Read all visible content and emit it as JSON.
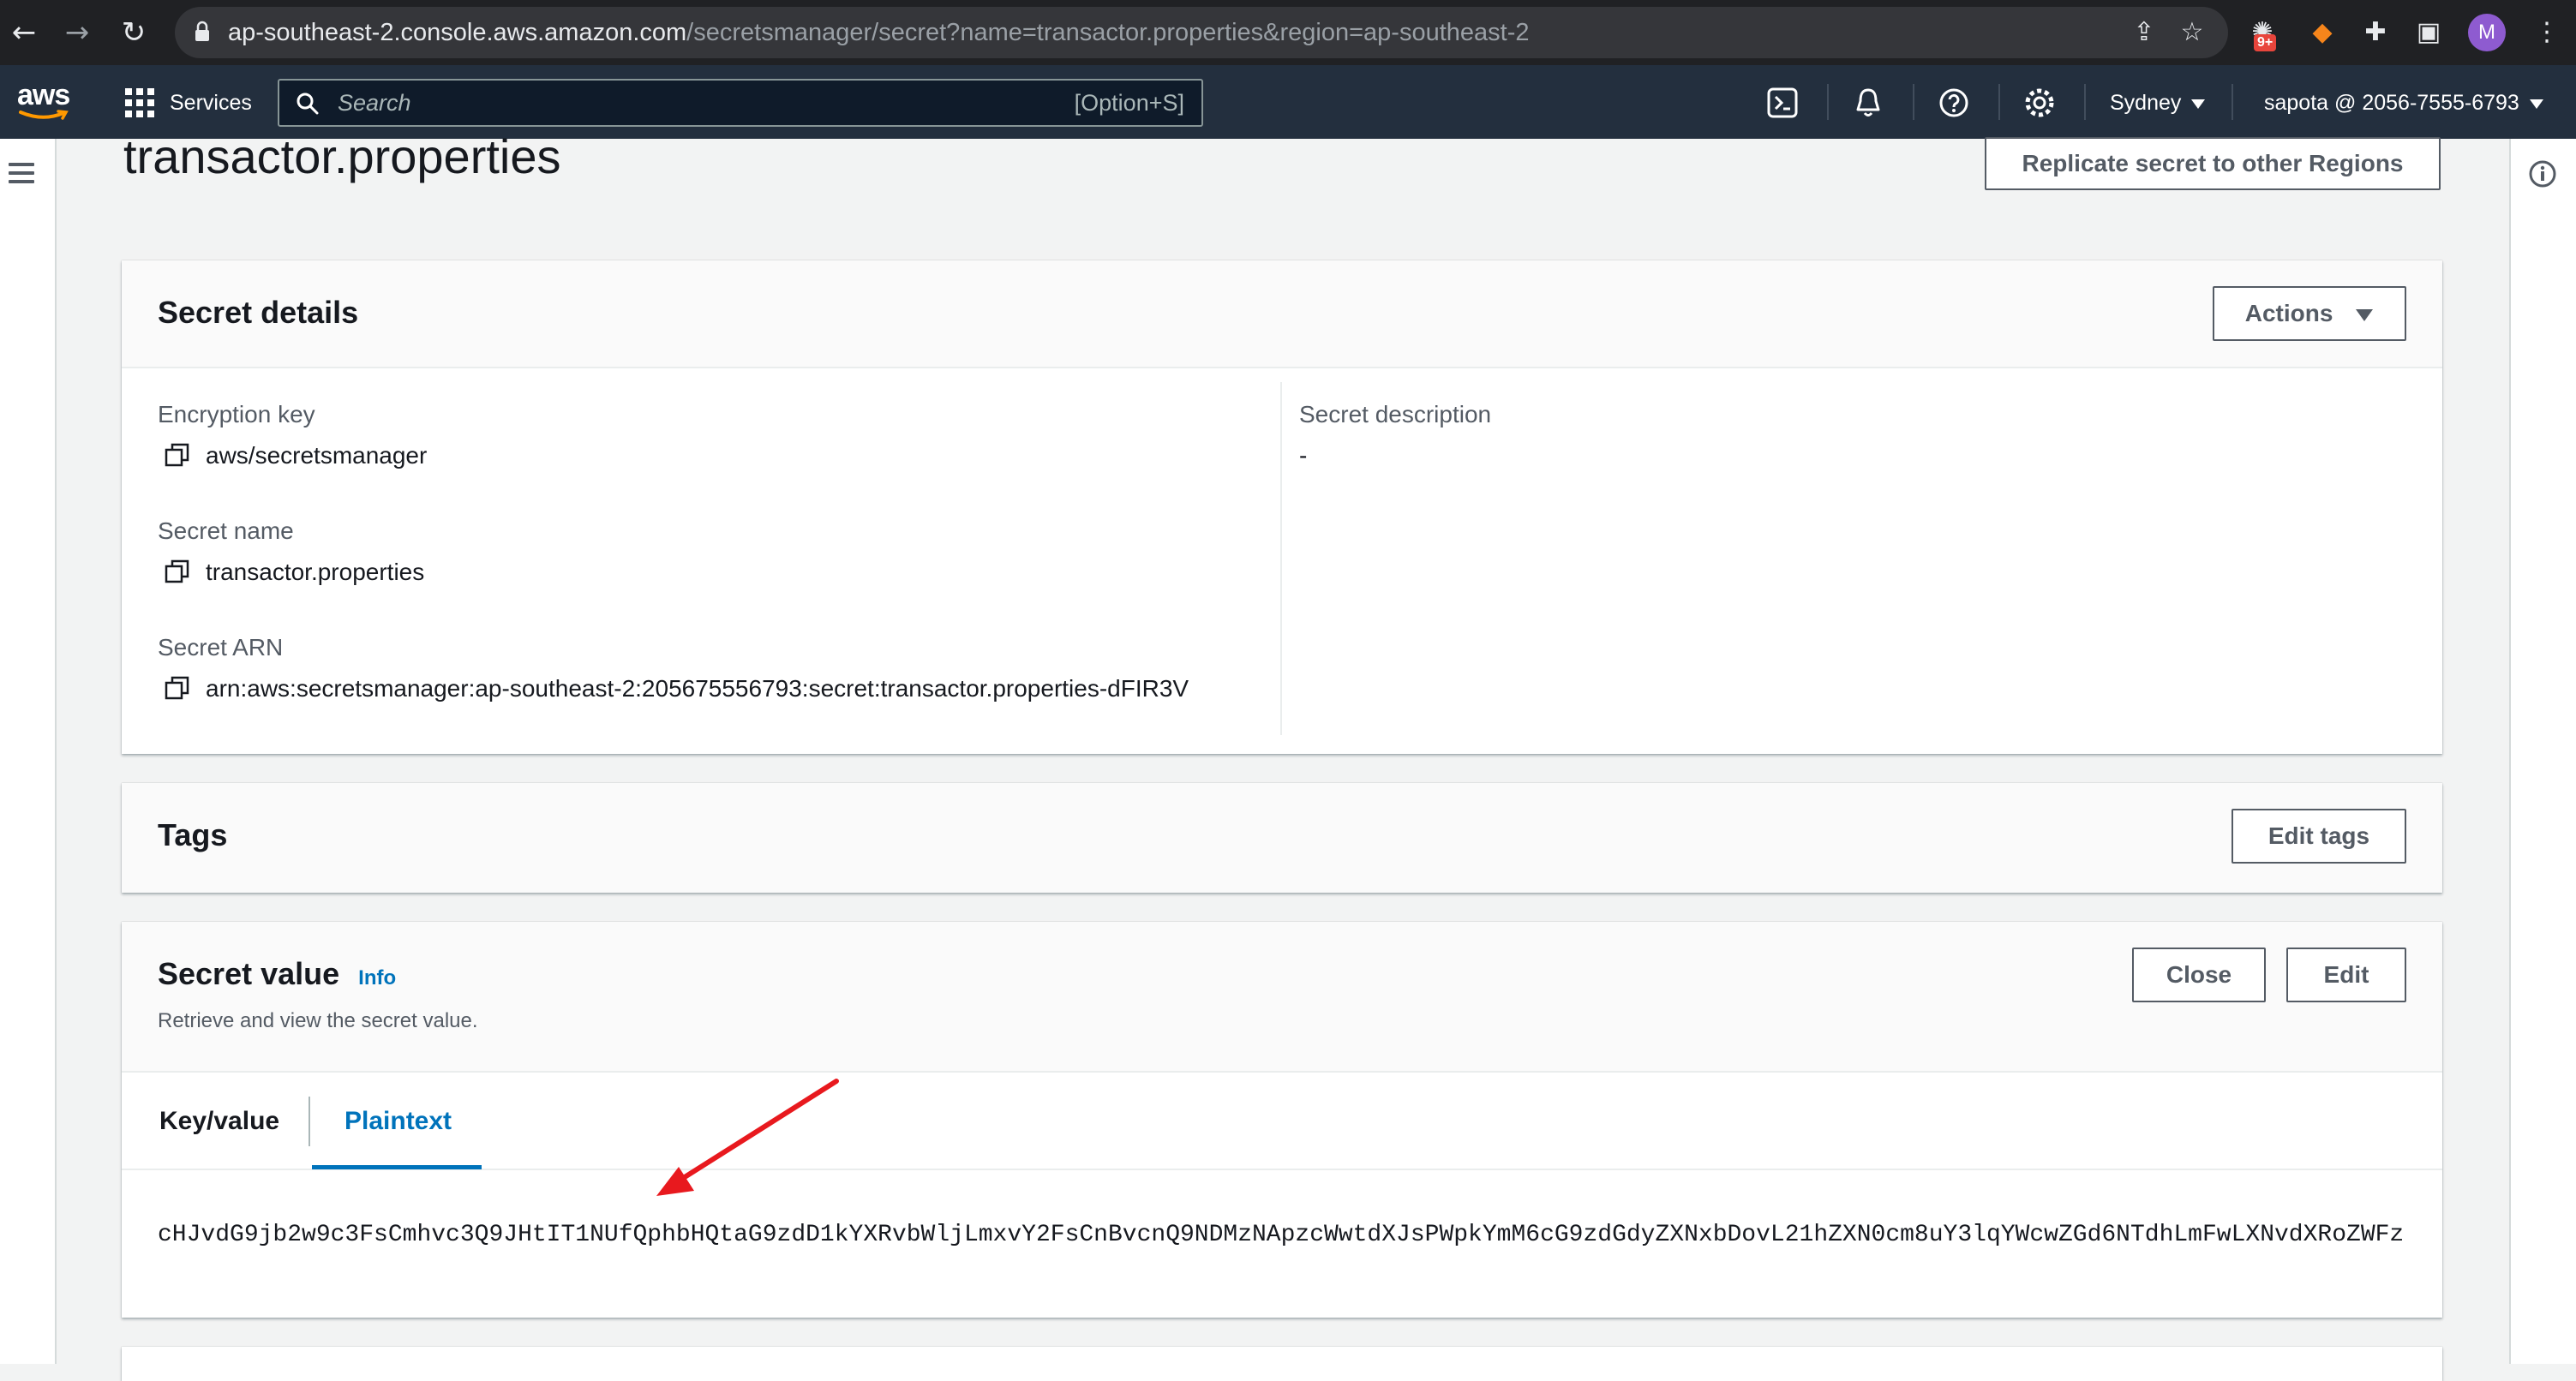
{
  "browser": {
    "url_host": "ap-southeast-2.console.aws.amazon.com",
    "url_path": "/secretsmanager/secret?name=transactor.properties&region=ap-southeast-2",
    "extension_badge": "9+",
    "profile_initial": "M"
  },
  "aws_nav": {
    "logo_text": "aws",
    "services_label": "Services",
    "search_placeholder": "Search",
    "search_shortcut": "[Option+S]",
    "region": "Sydney",
    "account": "sapota @ 2056-7555-6793",
    "brand_color": "#232f3e",
    "accent_color": "#ff9900"
  },
  "page": {
    "title": "transactor.properties",
    "replicate_button": "Replicate secret to other Regions"
  },
  "secret_details": {
    "title": "Secret details",
    "actions_button": "Actions",
    "encryption_key_label": "Encryption key",
    "encryption_key_value": "aws/secretsmanager",
    "secret_name_label": "Secret name",
    "secret_name_value": "transactor.properties",
    "secret_arn_label": "Secret ARN",
    "secret_arn_value": "arn:aws:secretsmanager:ap-southeast-2:205675556793:secret:transactor.properties-dFIR3V",
    "description_label": "Secret description",
    "description_value": "-"
  },
  "tags": {
    "title": "Tags",
    "edit_button": "Edit tags"
  },
  "secret_value": {
    "title": "Secret value",
    "info_link": "Info",
    "subtitle": "Retrieve and view the secret value.",
    "close_button": "Close",
    "edit_button": "Edit",
    "tabs": [
      "Key/value",
      "Plaintext"
    ],
    "active_tab": "Plaintext",
    "plaintext_value": "cHJvdG9jb2w9c3FsCmhvc3Q9JHtIT1NUfQphbHQtaG9zdD1kYXRvbWljLmxvY2FsCnBvcnQ9NDMzNApzcWwtdXJsPWpkYmM6cG9zdGdyZXNxbDovL21hZXN0cm8uY3lqYWcwZGd6NTdhLmFwLXNvdXRoZWFz"
  }
}
